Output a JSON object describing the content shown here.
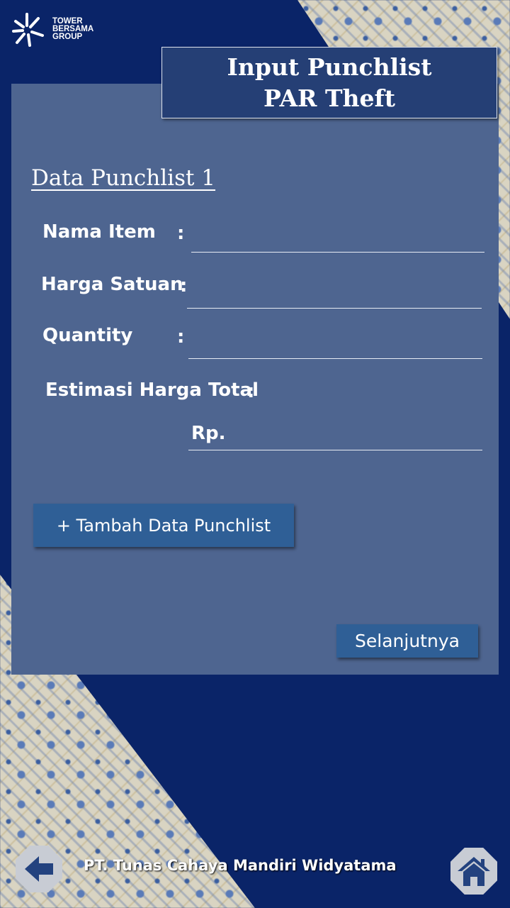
{
  "logo": {
    "line1": "TOWER",
    "line2": "BERSAMA",
    "line3": "GROUP"
  },
  "header": {
    "title_line1": "Input Punchlist",
    "title_line2": "PAR Theft"
  },
  "section": {
    "title": "Data Punchlist 1"
  },
  "form": {
    "nama_item_label": "Nama Item",
    "harga_satuan_label": "Harga Satuan",
    "quantity_label": "Quantity",
    "estimasi_label": "Estimasi Harga Total",
    "colon": ":",
    "currency_prefix": "Rp.",
    "nama_item_value": "",
    "harga_satuan_value": "",
    "quantity_value": "",
    "total_value": ""
  },
  "buttons": {
    "add_label": "+ Tambah Data Punchlist",
    "next_label": "Selanjutnya"
  },
  "footer": {
    "company": "PT. Tunas Cahaya Mandiri Widyatama"
  },
  "colors": {
    "background": "#0a2468",
    "panel": "#4e6590",
    "title_box": "#253f75",
    "button": "#2f5f96"
  },
  "icons": {
    "logo": "tower-bersama-logo-icon",
    "back": "arrow-left-icon",
    "home": "home-icon"
  }
}
